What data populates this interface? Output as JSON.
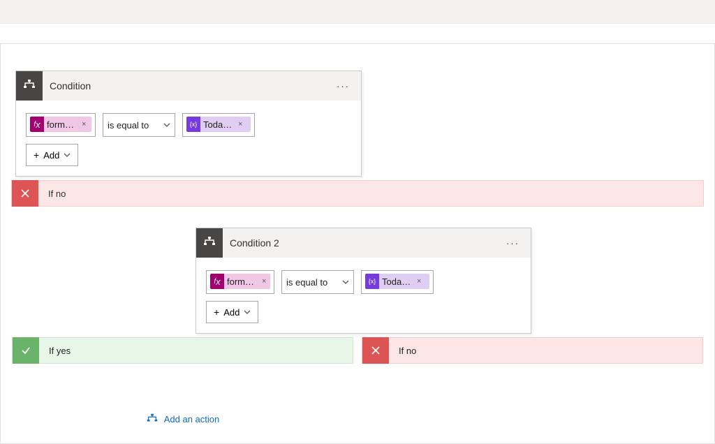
{
  "condition1": {
    "title": "Condition",
    "left_pill": {
      "icon": "fx",
      "label": "formatD…"
    },
    "operator": "is equal to",
    "right_pill": {
      "icon": "{x}",
      "label": "Todays d…"
    },
    "add_label": "Add"
  },
  "outer_branch_no": {
    "label": "If no"
  },
  "condition2": {
    "title": "Condition 2",
    "left_pill": {
      "icon": "fx",
      "label": "formatD…"
    },
    "operator": "is equal to",
    "right_pill": {
      "icon": "{x}",
      "label": "Todays d…"
    },
    "add_label": "Add"
  },
  "branches": {
    "yes": {
      "label": "If yes",
      "add_action": "Add an action"
    },
    "no": {
      "label": "If no"
    }
  }
}
